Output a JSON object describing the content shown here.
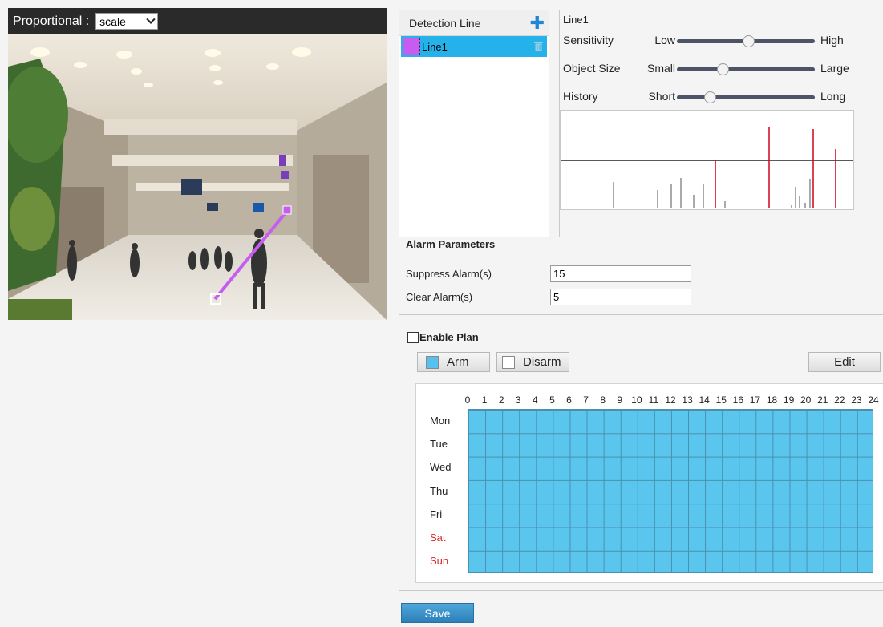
{
  "video": {
    "proportional_label": "Proportional :",
    "scale_value": "scale"
  },
  "detection_list": {
    "header": "Detection Line",
    "add_icon": "plus-icon",
    "items": [
      {
        "label": "Line1",
        "color": "#c65cf0",
        "selected": true
      }
    ]
  },
  "line_settings": {
    "name": "Line1",
    "sensitivity": {
      "label": "Sensitivity",
      "min": "Low",
      "max": "High",
      "level": 0.52
    },
    "object_size": {
      "label": "Object Size",
      "min": "Small",
      "max": "Large",
      "level": 0.33
    },
    "history": {
      "label": "History",
      "min": "Short",
      "max": "Long",
      "level": 0.24
    }
  },
  "alarm_parameters": {
    "title": "Alarm Parameters",
    "suppress_label": "Suppress Alarm(s)",
    "suppress_value": "15",
    "clear_label": "Clear Alarm(s)",
    "clear_value": "5"
  },
  "plan": {
    "enable_label": "Enable Plan",
    "enabled": false,
    "arm_label": "Arm",
    "disarm_label": "Disarm",
    "edit_label": "Edit",
    "arm_color": "#55c1ec",
    "hours": [
      "0",
      "1",
      "2",
      "3",
      "4",
      "5",
      "6",
      "7",
      "8",
      "9",
      "10",
      "11",
      "12",
      "13",
      "14",
      "15",
      "16",
      "17",
      "18",
      "19",
      "20",
      "21",
      "22",
      "23",
      "24"
    ],
    "days": [
      "Mon",
      "Tue",
      "Wed",
      "Thu",
      "Fri",
      "Sat",
      "Sun"
    ],
    "weekend_color": "#d62828"
  },
  "save_label": "Save"
}
